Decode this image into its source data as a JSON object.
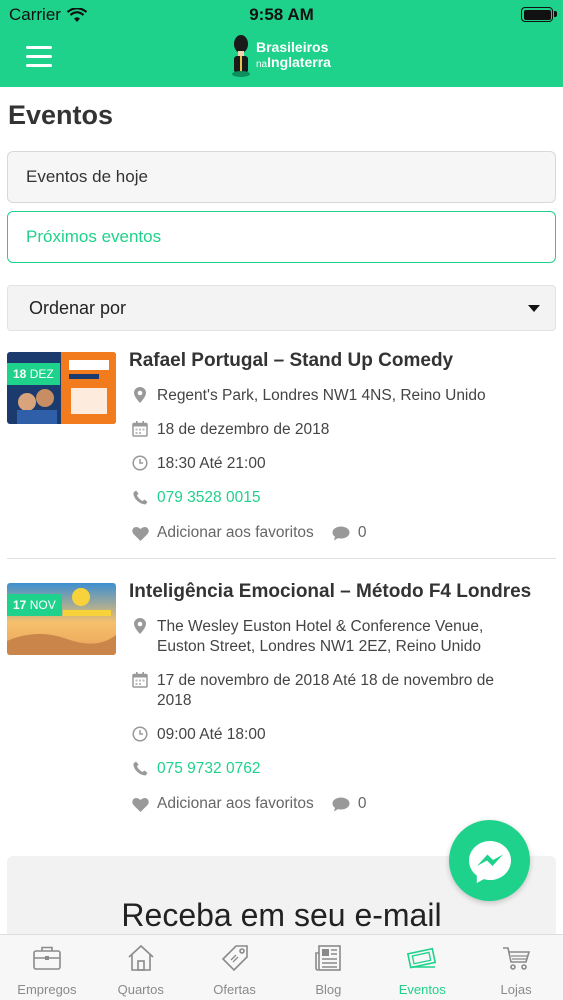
{
  "status_bar": {
    "carrier": "Carrier",
    "time": "9:58 AM"
  },
  "header": {
    "logo_line1": "Brasileiros",
    "logo_na": "na",
    "logo_line2": "Inglaterra",
    "accent_color": "#1ed28b"
  },
  "page": {
    "title": "Eventos"
  },
  "filters": {
    "today_label": "Eventos de hoje",
    "upcoming_label": "Próximos eventos",
    "sort_label": "Ordenar por"
  },
  "events": [
    {
      "badge_day": "18",
      "badge_month": "DEZ",
      "title": "Rafael Portugal – Stand Up Comedy",
      "address": "Regent's Park, Londres NW1 4NS, Reino Unido",
      "date": "18 de dezembro de 2018",
      "time": "18:30 Até 21:00",
      "phone": "079 3528 0015",
      "favorite_label": "Adicionar aos favoritos",
      "comment_count": "0"
    },
    {
      "badge_day": "17",
      "badge_month": "NOV",
      "title": "Inteligência Emocional – Método F4 Londres",
      "address_line1": "The Wesley Euston Hotel & Conference Venue,",
      "address_line2": "Euston Street, Londres NW1 2EZ, Reino Unido",
      "date_line1": "17 de novembro de 2018 Até 18 de novembro de",
      "date_line2": "2018",
      "time": "09:00 Até 18:00",
      "phone": "075 9732 0762",
      "favorite_label": "Adicionar aos favoritos",
      "comment_count": "0"
    }
  ],
  "newsletter": {
    "title": "Receba em seu e-mail"
  },
  "tabbar": {
    "items": [
      {
        "label": "Empregos",
        "icon": "briefcase-icon"
      },
      {
        "label": "Quartos",
        "icon": "house-icon"
      },
      {
        "label": "Ofertas",
        "icon": "price-tag-icon"
      },
      {
        "label": "Blog",
        "icon": "newspaper-icon"
      },
      {
        "label": "Eventos",
        "icon": "tickets-icon"
      },
      {
        "label": "Lojas",
        "icon": "shopping-cart-icon"
      }
    ],
    "active": "Eventos"
  }
}
